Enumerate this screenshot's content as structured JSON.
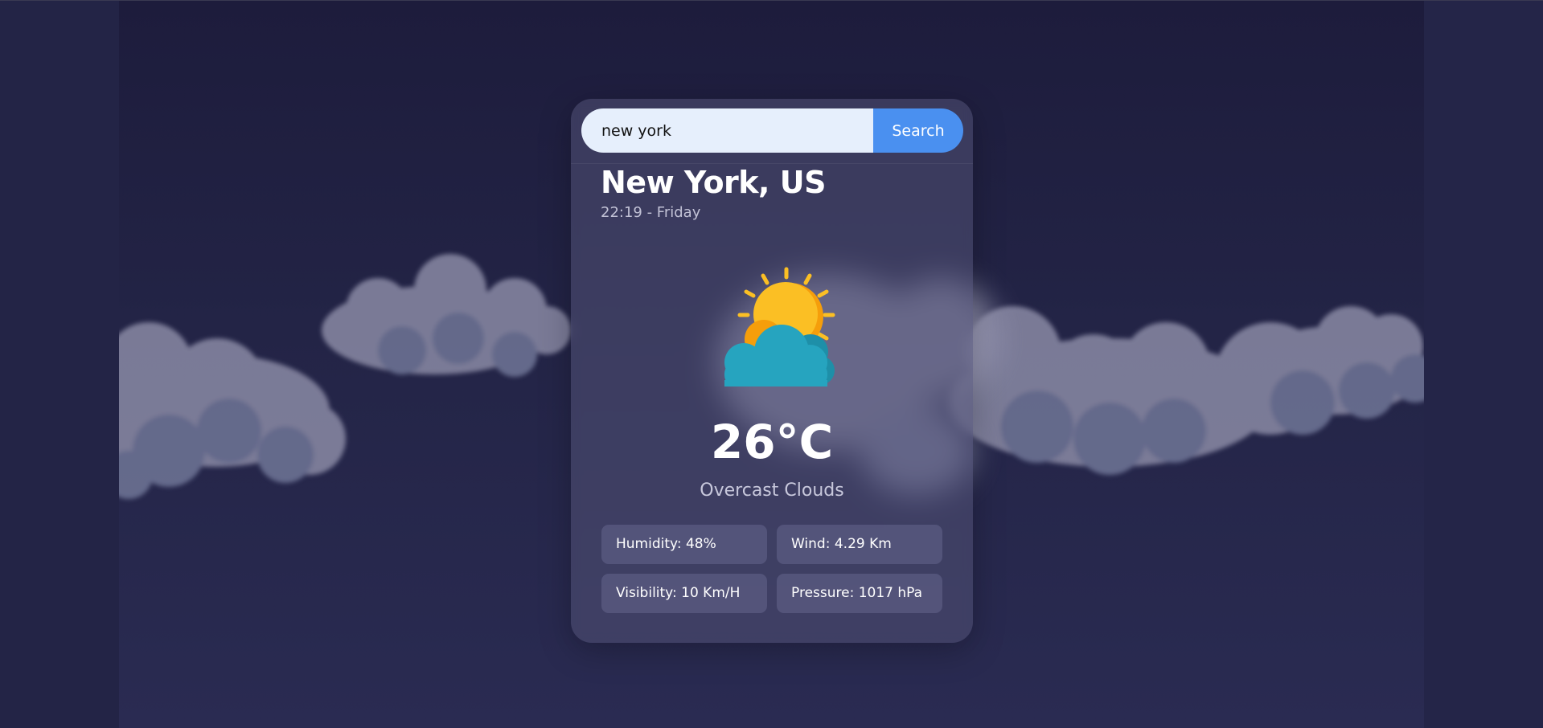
{
  "search": {
    "value": "new york",
    "button_label": "Search"
  },
  "location": {
    "city": "New York, US",
    "datetime": "22:19 - Friday"
  },
  "current": {
    "temperature": "26°C",
    "description": "Overcast Clouds",
    "icon": "partly-cloudy-icon"
  },
  "stats": {
    "humidity": "Humidity: 48%",
    "wind": "Wind: 4.29 Km",
    "visibility": "Visibility: 10 Km/H",
    "pressure": "Pressure: 1017 hPa"
  },
  "colors": {
    "accent": "#4a90f0",
    "sun": "#fbbf24",
    "cloud": "#26a4bf"
  }
}
